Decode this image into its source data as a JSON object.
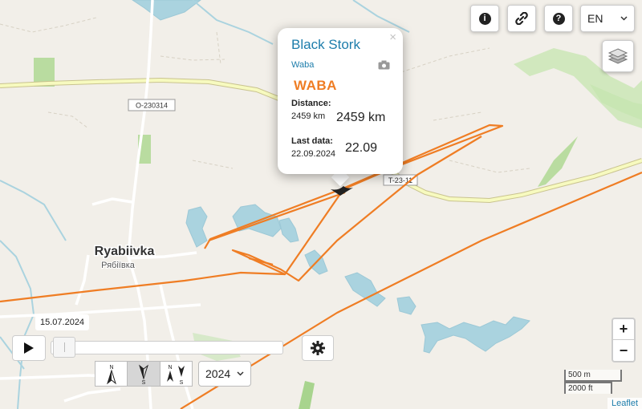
{
  "map": {
    "town_name": "Ryabiivka",
    "town_name_local": "Рябіївка",
    "road_o": "O-230314",
    "road_t": "T-23-11",
    "colors": {
      "track": "#ef7d24",
      "water": "#aad3df",
      "road_yellow": "#f7fabf",
      "land": "#f2efe9",
      "green": "#c8e6b3"
    }
  },
  "toolbar": {
    "info_icon": "info-icon",
    "link_icon": "link-icon",
    "help_icon": "help-icon",
    "language": "EN",
    "layers_icon": "layers-icon"
  },
  "popup": {
    "title": "Black Stork",
    "subtitle": "Waba",
    "brand": "WABA",
    "distance_label": "Distance:",
    "distance_small": "2459 km",
    "distance_big": "2459 km",
    "lastdata_label": "Last data:",
    "lastdata_small": "22.09.2024",
    "lastdata_big": "22.09",
    "close": "×"
  },
  "timeline": {
    "date_label": "15.07.2024",
    "progress": 0,
    "year": "2024"
  },
  "zoom": {
    "in": "+",
    "out": "−"
  },
  "scale": {
    "metric": "500 m",
    "imperial": "2000 ft"
  },
  "attribution": "Leaflet"
}
